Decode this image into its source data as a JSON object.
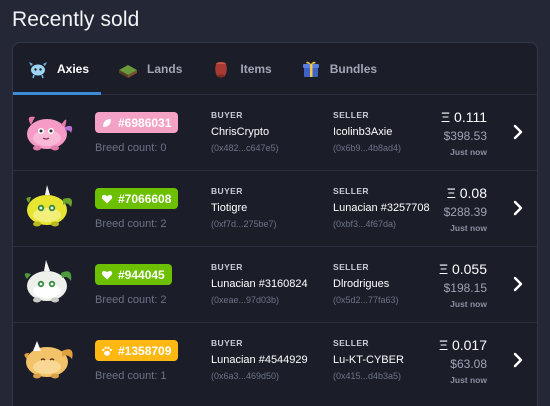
{
  "page": {
    "title": "Recently sold"
  },
  "tabs": [
    {
      "label": "Axies",
      "icon": "axie-icon",
      "active": true
    },
    {
      "label": "Lands",
      "icon": "land-icon",
      "active": false
    },
    {
      "label": "Items",
      "icon": "item-icon",
      "active": false
    },
    {
      "label": "Bundles",
      "icon": "bundle-icon",
      "active": false
    }
  ],
  "columns": {
    "buyer": "BUYER",
    "seller": "SELLER"
  },
  "sales": [
    {
      "axie_class_icon": "leaf-icon",
      "badge_color": "#f3a2c6",
      "id": "#6986031",
      "breed_count": "Breed count: 0",
      "buyer_name": "ChrisCrypto",
      "buyer_addr": "(0x482...c647e5)",
      "seller_name": "Icolinb3Axie",
      "seller_addr": "(0x6b9...4b8ad4)",
      "price_eth": "Ξ 0.111",
      "price_usd": "$398.53",
      "time": "Just now"
    },
    {
      "axie_class_icon": "heart-icon",
      "badge_color": "#6cc000",
      "id": "#7066608",
      "breed_count": "Breed count: 2",
      "buyer_name": "Tiotigre",
      "buyer_addr": "(0xf7d...275be7)",
      "seller_name": "Lunacian #3257708",
      "seller_addr": "(0xbf3...4f67da)",
      "price_eth": "Ξ 0.08",
      "price_usd": "$288.39",
      "time": "Just now"
    },
    {
      "axie_class_icon": "heart-icon",
      "badge_color": "#6cc000",
      "id": "#944045",
      "breed_count": "Breed count: 2",
      "buyer_name": "Lunacian #3160824",
      "buyer_addr": "(0xeae...97d03b)",
      "seller_name": "Dlrodrigues",
      "seller_addr": "(0x5d2...77fa63)",
      "price_eth": "Ξ 0.055",
      "price_usd": "$198.15",
      "time": "Just now"
    },
    {
      "axie_class_icon": "paw-icon",
      "badge_color": "#ffb812",
      "id": "#1358709",
      "breed_count": "Breed count: 1",
      "buyer_name": "Lunacian #4544929",
      "buyer_addr": "(0x6a3...469d50)",
      "seller_name": "Lu-KT-CYBER",
      "seller_addr": "(0x415...d4b3a5)",
      "price_eth": "Ξ 0.017",
      "price_usd": "$63.08",
      "time": "Just now"
    }
  ]
}
